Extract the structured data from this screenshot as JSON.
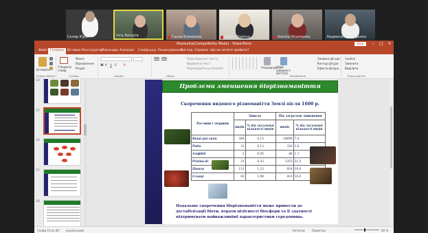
{
  "participants": [
    {
      "name": "Скляр Юрій",
      "muted": false
    },
    {
      "name": "Inna Bahynia",
      "muted": false
    },
    {
      "name": "Ганна Клименко",
      "muted": true
    },
    {
      "name": "Надія Zhatova",
      "muted": true
    },
    {
      "name": "Natalia Hruzmenko",
      "muted": true
    },
    {
      "name": "Людмила Бондаренко",
      "muted": false
    }
  ],
  "window": {
    "title": "Ekoosvita(Compatibility Mode) - PowerPoint",
    "signin": "Вхід"
  },
  "tabs": [
    "Файл",
    "Головна",
    "Вставка",
    "Конструктор",
    "Переходи",
    "Анімація",
    "Слайд-шоу",
    "Рецензування",
    "Вигляд",
    "Справка",
    "Що ви хочете зробити?"
  ],
  "ribbon": {
    "paste": "Вставити",
    "clipboard": "Буфер обміну",
    "new_slide": "Створити слайд",
    "layout": "Макет",
    "reset": "Відновлення",
    "section": "Розділ",
    "slides": "Слайди",
    "font": "Шрифт",
    "paragraph": "Абзац",
    "text_dir": "Перетворення тексту",
    "align_text": "Вирівняти текст",
    "smartart": "Перетворити на SmartArt",
    "arrange": "Упорядкувати",
    "quick_styles": "Стилі швидкого доступу",
    "drawing": "Малювання",
    "find": "Знайти",
    "replace": "Замінити",
    "select": "Виділити",
    "editing": "Редагування",
    "shape_fill": "Заливка фігури",
    "shape_outline": "Контур фігури",
    "shape_effects": "Ефекти фігури"
  },
  "thumbs": [
    {
      "num": "14"
    },
    {
      "num": "15"
    },
    {
      "num": "16"
    },
    {
      "num": "17"
    },
    {
      "num": "18"
    }
  ],
  "slide": {
    "title": "Проблеми зменшення біорізноманіття",
    "subtitle": "Скорочення видового різноманіття Землі після 1600 р.",
    "headers": {
      "group": "Рослини і тварини",
      "extinct": "Зникло",
      "threat": "Під загрозою зникнення",
      "species": "видів",
      "pct": "% від загальної кількості видів"
    },
    "rows": [
      {
        "group": "Вищі рослини",
        "e_n": "384",
        "e_p": "0,15",
        "t_n": "18699",
        "t_p": "7,4"
      },
      {
        "group": "Риби",
        "e_n": "23",
        "e_p": "0,12",
        "t_n": "320",
        "t_p": "1,6"
      },
      {
        "group": "Амфібії",
        "e_n": "2",
        "e_p": "0,05",
        "t_n": "48",
        "t_p": "1,1"
      },
      {
        "group": "Рептилії",
        "e_n": "21",
        "e_p": "0,33",
        "t_n": "1355",
        "t_p": "21,5"
      },
      {
        "group": "Птахи",
        "e_n": "113",
        "e_p": "1,23",
        "t_n": "924",
        "t_p": "10,0"
      },
      {
        "group": "Ссавці",
        "e_n": "83",
        "e_p": "1,99",
        "t_n": "414",
        "t_p": "10,0"
      }
    ],
    "footer": "Подальше скорочення біорізноманіття може привести до дестабілізації біоти, втрати цілісності біосфери та її здатності підтримувати найважливіші характеристики середовища."
  },
  "status": {
    "slide_info": "Слайд 15 из 49",
    "language": "український",
    "notes": "Нотатки",
    "comments": "Примітки",
    "zoom": "60 %"
  }
}
